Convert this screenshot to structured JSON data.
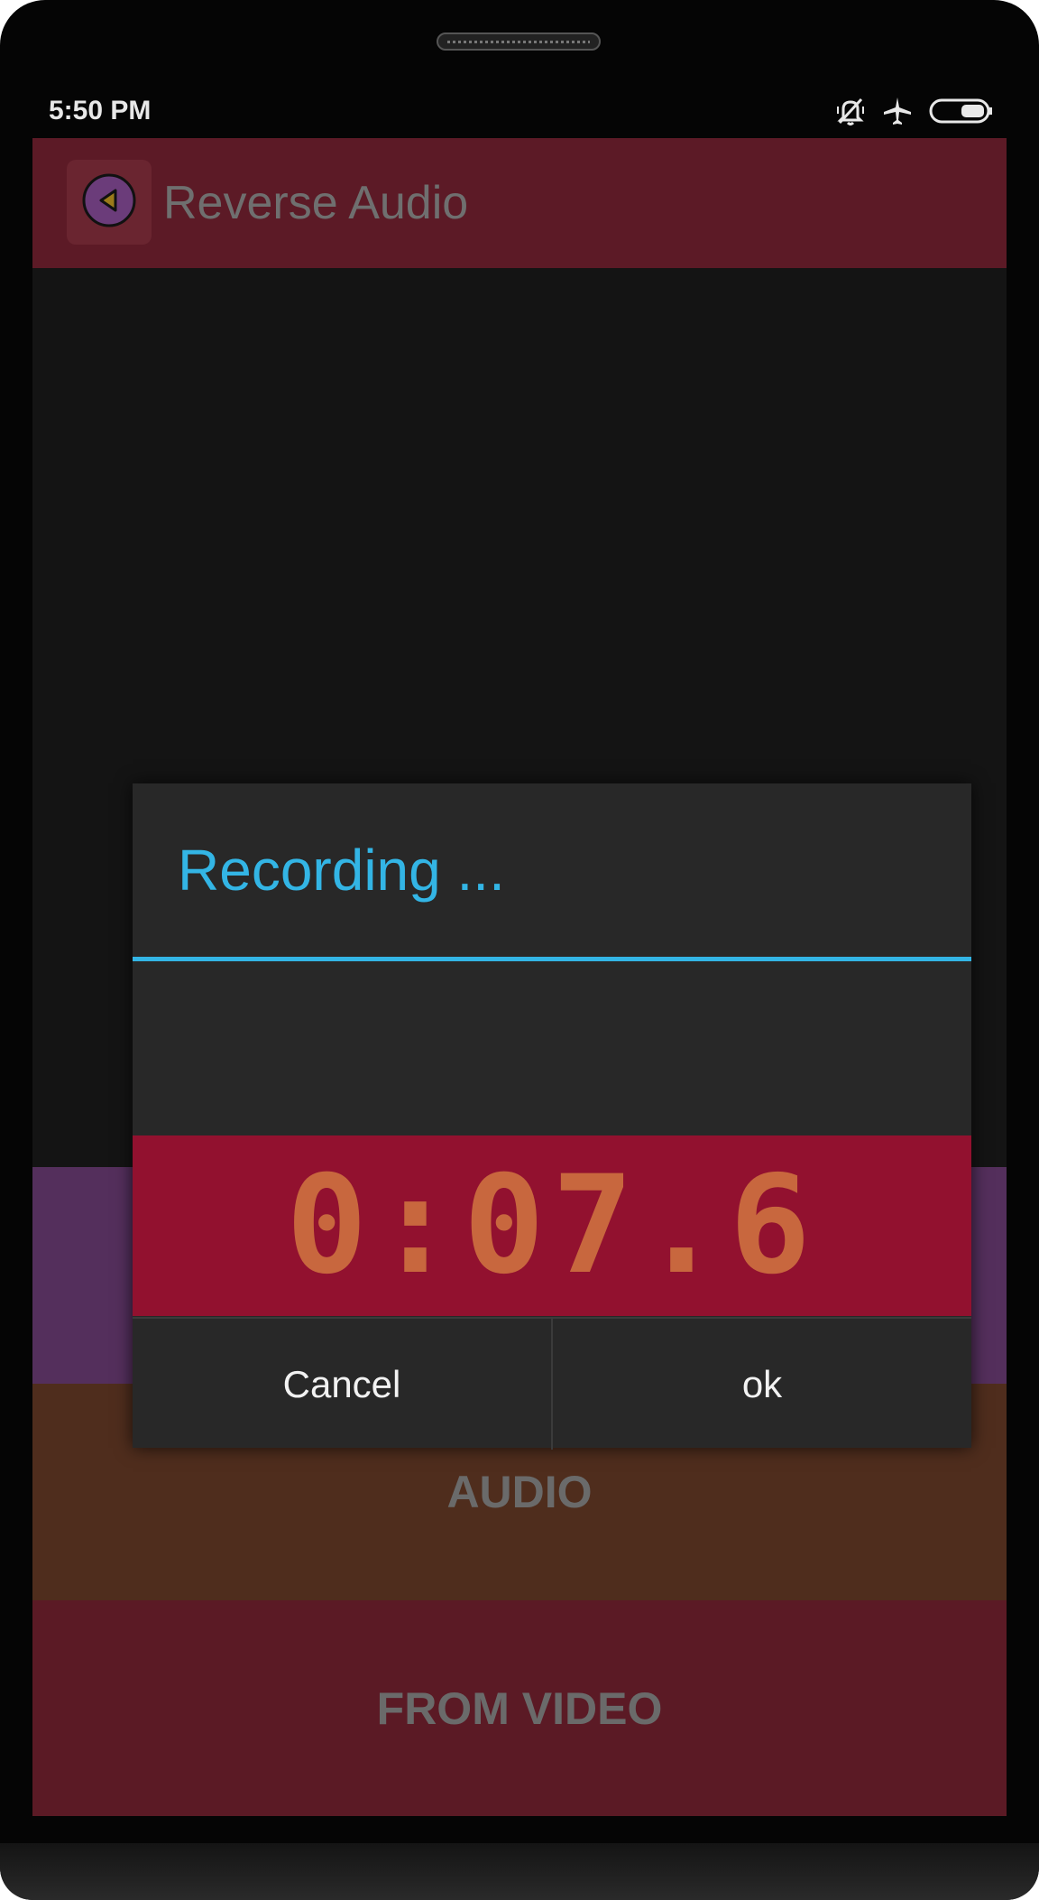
{
  "status_bar": {
    "time": "5:50 PM",
    "icons": [
      "bell-off-icon",
      "airplane-icon",
      "battery-icon"
    ]
  },
  "app_bar": {
    "back_icon": "back-triangle-icon",
    "title": "Reverse Audio"
  },
  "bands": {
    "purple_label": "",
    "audio_label": "AUDIO",
    "video_label": "FROM VIDEO"
  },
  "dialog": {
    "title": "Recording ...",
    "timer": "0:07.6",
    "cancel_label": "Cancel",
    "ok_label": "ok"
  },
  "colors": {
    "accent_blue": "#33b5e5",
    "appbar": "#5c1a26",
    "timer_bg": "#92112f",
    "timer_text": "#c8673e",
    "band_purple": "#542f5c",
    "band_audio": "#4f2d1d",
    "band_video": "#5b1a25"
  }
}
